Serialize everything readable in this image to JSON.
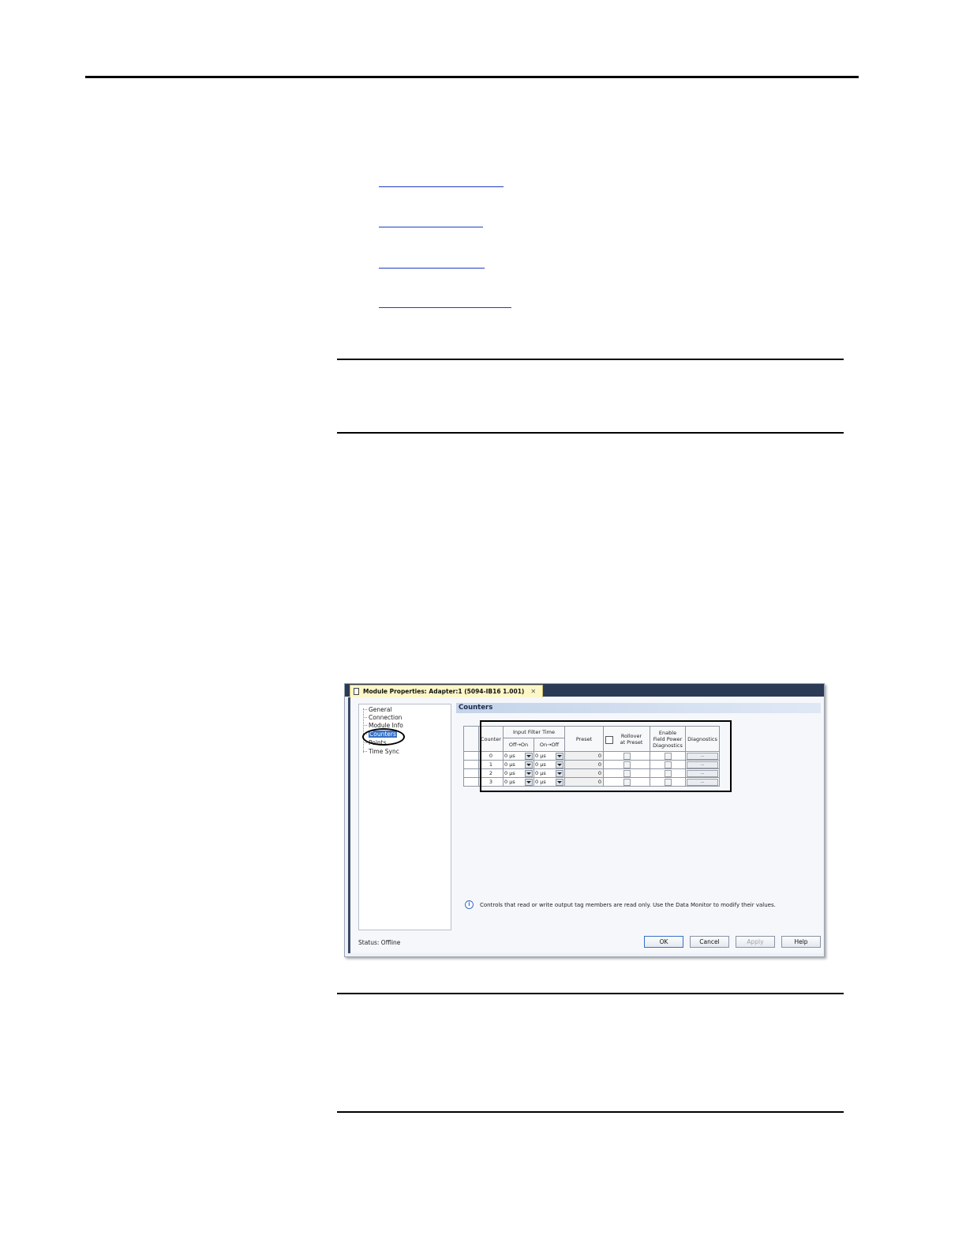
{
  "dialog": {
    "title": "Module Properties: Adapter:1 (5094-IB16 1.001)",
    "close_glyph": "✕",
    "tree": [
      "General",
      "Connection",
      "Module Info",
      "Counters",
      "Points",
      "Time Sync"
    ],
    "selected": "Counters",
    "section_title": "Counters",
    "table": {
      "h_counter": "Counter",
      "h_filter": "Input Filter Time",
      "h_offon": "Off→On",
      "h_onoff": "On→Off",
      "h_preset": "Preset",
      "h_rollover_1": "Rollover",
      "h_rollover_2": "at Preset",
      "h_enable_1": "Enable",
      "h_enable_2": "Field Power",
      "h_enable_3": "Diagnostics",
      "h_diag": "Diagnostics",
      "rows": [
        {
          "counter": "0",
          "offon": "0 µs",
          "onoff": "0 µs",
          "preset": "0",
          "diag": "..."
        },
        {
          "counter": "1",
          "offon": "0 µs",
          "onoff": "0 µs",
          "preset": "0",
          "diag": "..."
        },
        {
          "counter": "2",
          "offon": "0 µs",
          "onoff": "0 µs",
          "preset": "0",
          "diag": "..."
        },
        {
          "counter": "3",
          "offon": "0 µs",
          "onoff": "0 µs",
          "preset": "0",
          "diag": "..."
        }
      ]
    },
    "info_text": "Controls that read or write output tag members are read only. Use the Data Monitor to modify their values.",
    "status": "Status:  Offline",
    "buttons": {
      "ok": "OK",
      "cancel": "Cancel",
      "apply": "Apply",
      "help": "Help"
    }
  }
}
